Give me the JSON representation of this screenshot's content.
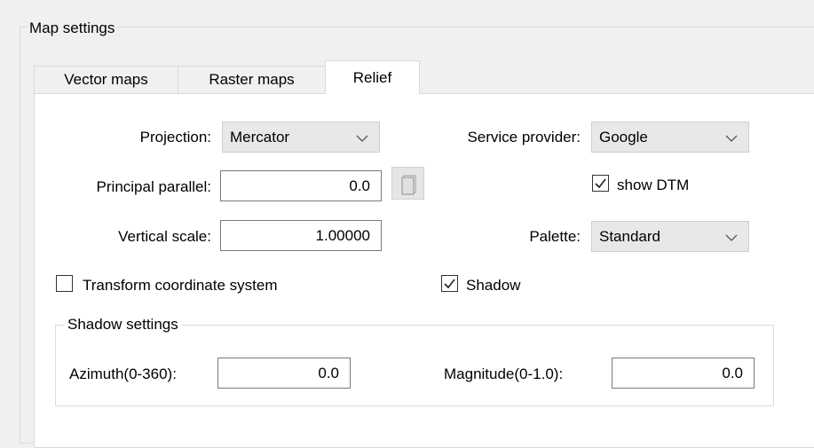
{
  "group": {
    "title": "Map settings"
  },
  "tabs": [
    {
      "label": "Vector maps",
      "active": false
    },
    {
      "label": "Raster maps",
      "active": false
    },
    {
      "label": "Relief",
      "active": true
    }
  ],
  "relief": {
    "projection": {
      "label": "Projection:",
      "value": "Mercator"
    },
    "service_provider": {
      "label": "Service provider:",
      "value": "Google"
    },
    "principal_parallel": {
      "label": "Principal parallel:",
      "value": "0.0"
    },
    "show_dtm": {
      "label": "show DTM",
      "checked": true
    },
    "vertical_scale": {
      "label": "Vertical scale:",
      "value": "1.00000"
    },
    "palette": {
      "label": "Palette:",
      "value": "Standard"
    },
    "transform_coordinate_system": {
      "label": "Transform coordinate system",
      "checked": false
    },
    "shadow": {
      "label": "Shadow",
      "checked": true
    },
    "shadow_settings": {
      "title": "Shadow settings",
      "azimuth": {
        "label": "Azimuth(0-360):",
        "value": "0.0"
      },
      "magnitude": {
        "label": "Magnitude(0-1.0):",
        "value": "0.0"
      }
    }
  },
  "icons": {
    "dropdown": "chevron-down-icon",
    "checkmark": "checkmark-icon",
    "copy": "copy-icon"
  }
}
